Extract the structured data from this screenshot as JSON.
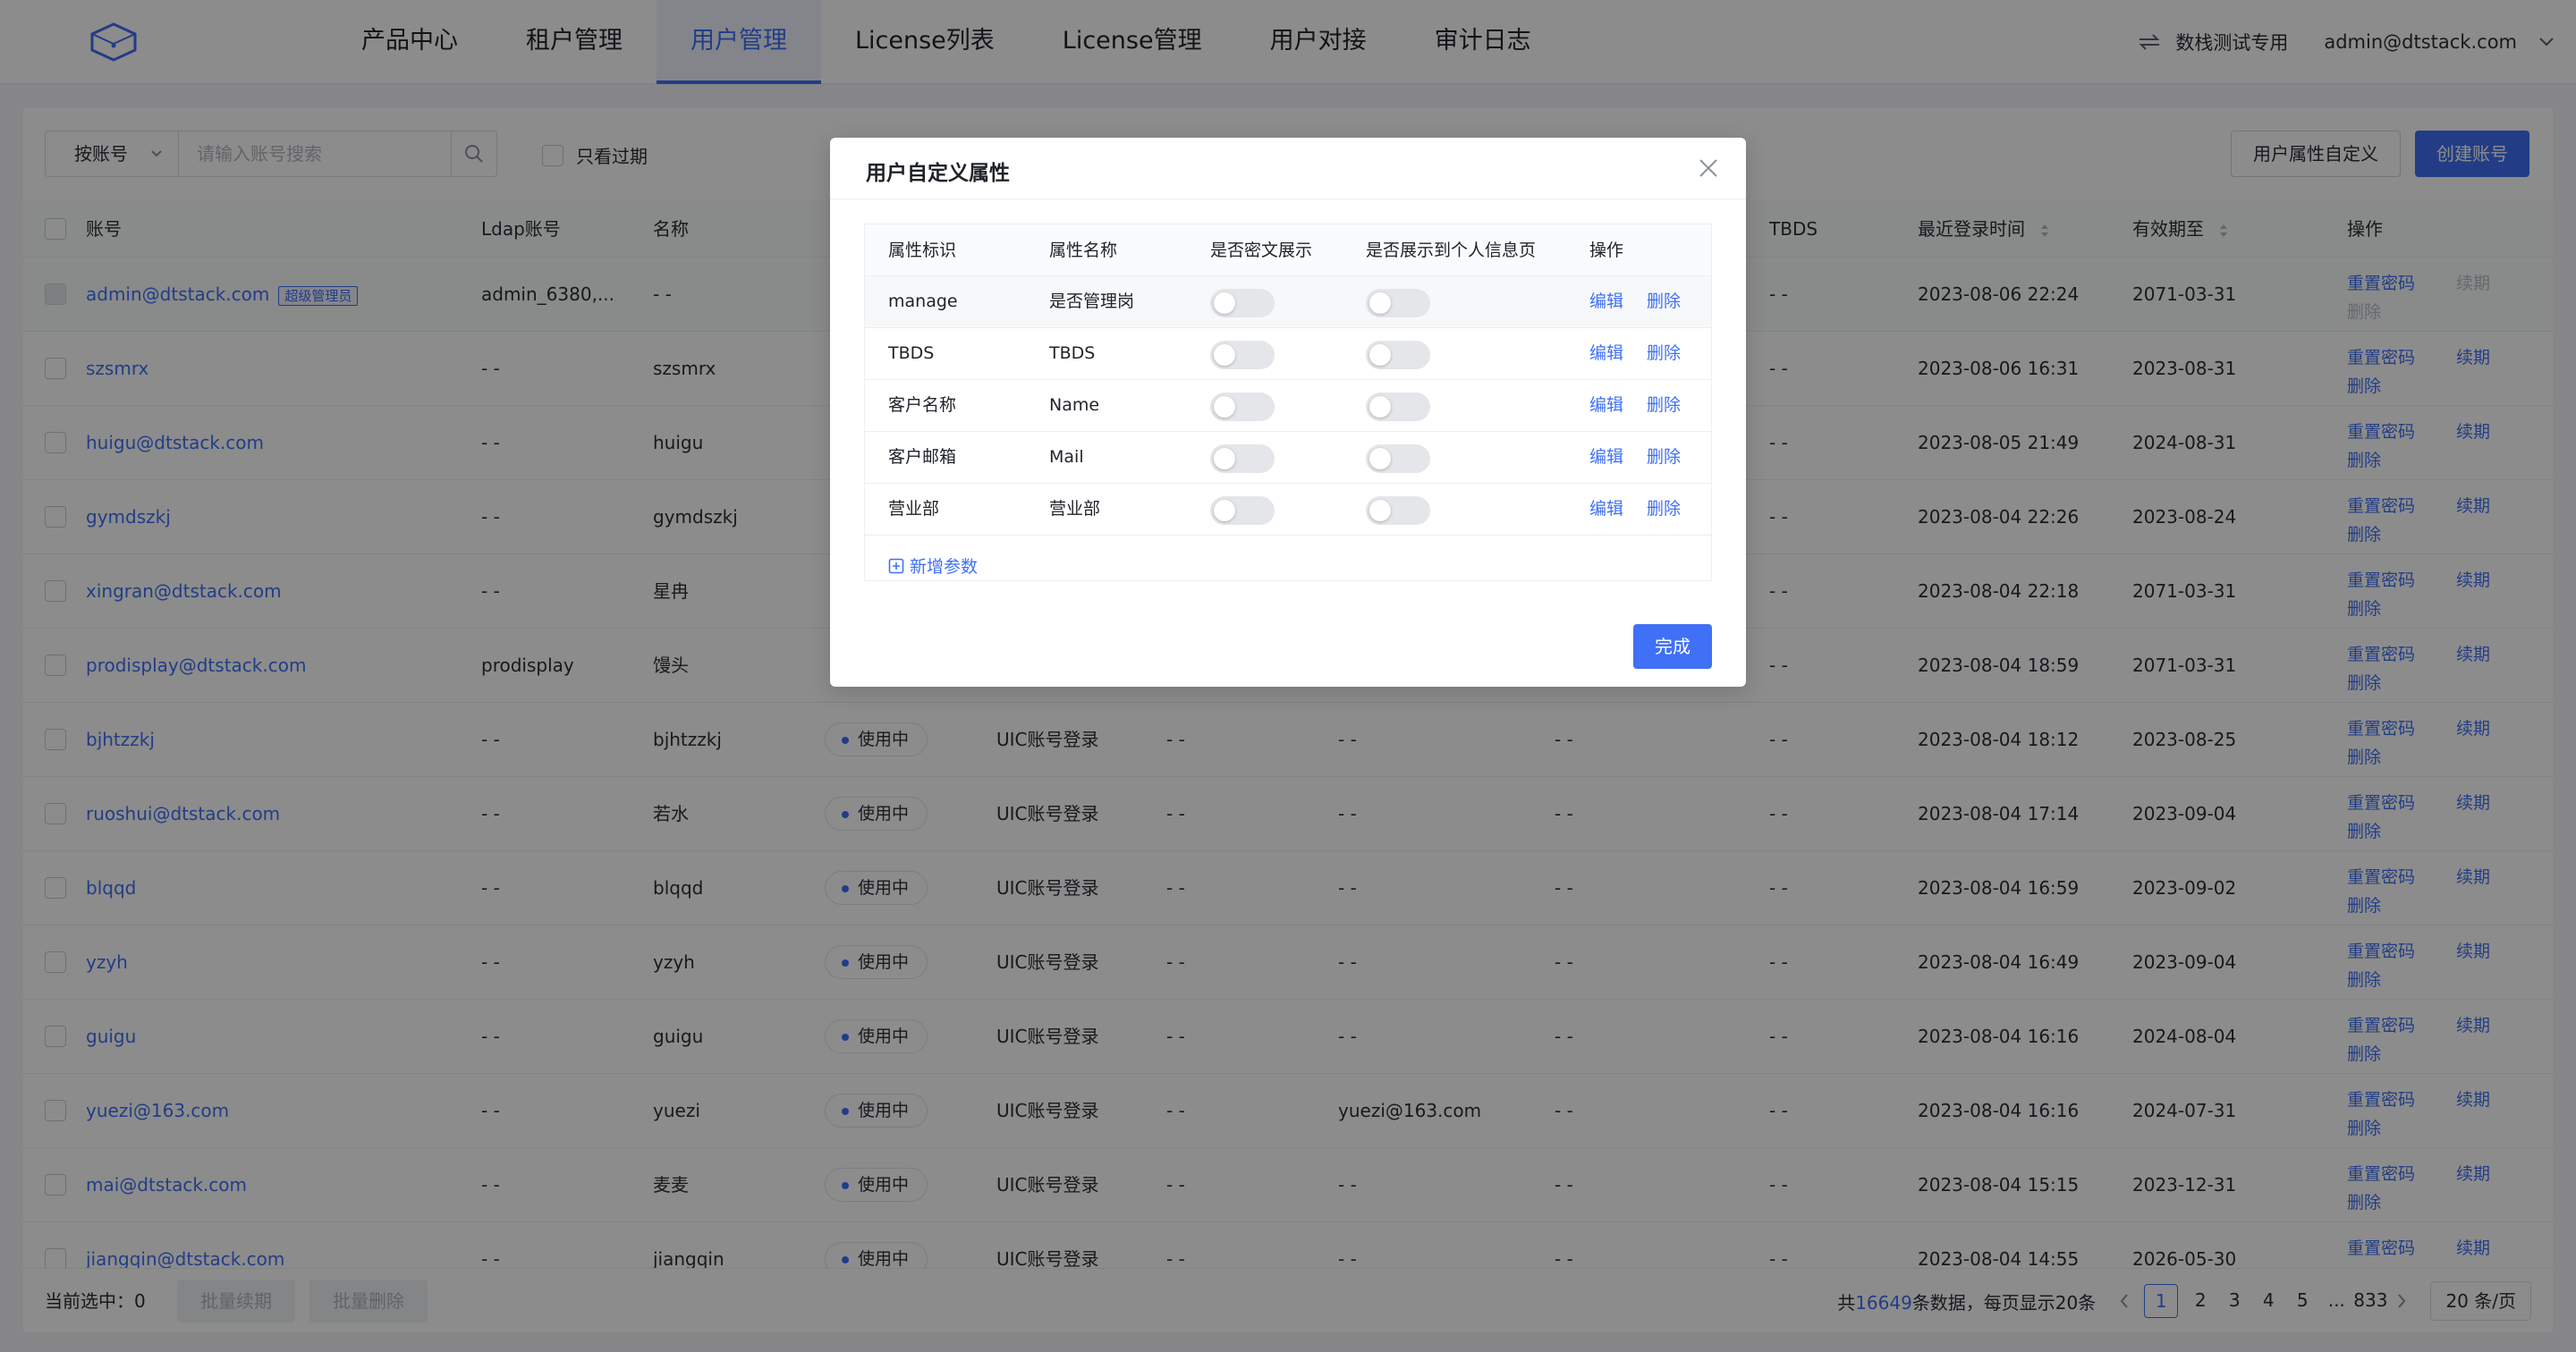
{
  "header": {
    "nav": [
      "产品中心",
      "租户管理",
      "用户管理",
      "License列表",
      "License管理",
      "用户对接",
      "审计日志"
    ],
    "active_nav": "用户管理",
    "project": "数栈测试专用",
    "user": "admin@dtstack.com",
    "accent_color": "#3f70f5"
  },
  "toolbar": {
    "search_mode": "按账号",
    "search_placeholder": "请输入账号搜索",
    "only_expired": "只看过期",
    "attr_button": "用户属性自定义",
    "create_button": "创建账号"
  },
  "table": {
    "columns": [
      "账号",
      "Ldap账号",
      "名称",
      "TBDS",
      "最近登录时间",
      "有效期至",
      "操作"
    ],
    "admin_tag": "超级管理员",
    "ops": {
      "reset": "重置密码",
      "renew": "续期",
      "delete": "删除"
    },
    "rows": [
      {
        "account": "admin@dtstack.com",
        "ldap": "admin_6380,...",
        "name": "- -",
        "status": "",
        "login_type": "",
        "c1": "",
        "c2": "",
        "c3": "",
        "tbds": "- -",
        "last_login": "2023-08-06 22:24",
        "expire": "2071-03-31",
        "admin": true
      },
      {
        "account": "szsmrx",
        "ldap": "- -",
        "name": "szsmrx",
        "status": "",
        "login_type": "",
        "c1": "",
        "c2": "",
        "c3": "",
        "tbds": "- -",
        "last_login": "2023-08-06 16:31",
        "expire": "2023-08-31"
      },
      {
        "account": "huigu@dtstack.com",
        "ldap": "- -",
        "name": "huigu",
        "status": "",
        "login_type": "",
        "c1": "",
        "c2": "",
        "c3": "",
        "tbds": "- -",
        "last_login": "2023-08-05 21:49",
        "expire": "2024-08-31"
      },
      {
        "account": "gymdszkj",
        "ldap": "- -",
        "name": "gymdszkj",
        "status": "",
        "login_type": "",
        "c1": "",
        "c2": "",
        "c3": "",
        "tbds": "- -",
        "last_login": "2023-08-04 22:26",
        "expire": "2023-08-24"
      },
      {
        "account": "xingran@dtstack.com",
        "ldap": "- -",
        "name": "星冉",
        "status": "",
        "login_type": "",
        "c1": "",
        "c2": "",
        "c3": "",
        "tbds": "- -",
        "last_login": "2023-08-04 22:18",
        "expire": "2071-03-31"
      },
      {
        "account": "prodisplay@dtstack.com",
        "ldap": "prodisplay",
        "name": "馒头",
        "status": "",
        "login_type": "",
        "c1": "",
        "c2": "",
        "c3": "",
        "tbds": "- -",
        "last_login": "2023-08-04 18:59",
        "expire": "2071-03-31"
      },
      {
        "account": "bjhtzzkj",
        "ldap": "- -",
        "name": "bjhtzzkj",
        "status": "使用中",
        "login_type": "UIC账号登录",
        "c1": "- -",
        "c2": "- -",
        "c3": "- -",
        "tbds": "- -",
        "last_login": "2023-08-04 18:12",
        "expire": "2023-08-25"
      },
      {
        "account": "ruoshui@dtstack.com",
        "ldap": "- -",
        "name": "若水",
        "status": "使用中",
        "login_type": "UIC账号登录",
        "c1": "- -",
        "c2": "- -",
        "c3": "- -",
        "tbds": "- -",
        "last_login": "2023-08-04 17:14",
        "expire": "2023-09-04"
      },
      {
        "account": "blqqd",
        "ldap": "- -",
        "name": "blqqd",
        "status": "使用中",
        "login_type": "UIC账号登录",
        "c1": "- -",
        "c2": "- -",
        "c3": "- -",
        "tbds": "- -",
        "last_login": "2023-08-04 16:59",
        "expire": "2023-09-02"
      },
      {
        "account": "yzyh",
        "ldap": "- -",
        "name": "yzyh",
        "status": "使用中",
        "login_type": "UIC账号登录",
        "c1": "- -",
        "c2": "- -",
        "c3": "- -",
        "tbds": "- -",
        "last_login": "2023-08-04 16:49",
        "expire": "2023-09-04"
      },
      {
        "account": "guigu",
        "ldap": "- -",
        "name": "guigu",
        "status": "使用中",
        "login_type": "UIC账号登录",
        "c1": "- -",
        "c2": "- -",
        "c3": "- -",
        "tbds": "- -",
        "last_login": "2023-08-04 16:16",
        "expire": "2024-08-04"
      },
      {
        "account": "yuezi@163.com",
        "ldap": "- -",
        "name": "yuezi",
        "status": "使用中",
        "login_type": "UIC账号登录",
        "c1": "- -",
        "c2": "yuezi@163.com",
        "c3": "- -",
        "tbds": "- -",
        "last_login": "2023-08-04 16:16",
        "expire": "2024-07-31"
      },
      {
        "account": "mai@dtstack.com",
        "ldap": "- -",
        "name": "麦麦",
        "status": "使用中",
        "login_type": "UIC账号登录",
        "c1": "- -",
        "c2": "- -",
        "c3": "- -",
        "tbds": "- -",
        "last_login": "2023-08-04 15:15",
        "expire": "2023-12-31"
      },
      {
        "account": "jiangqin@dtstack.com",
        "ldap": "- -",
        "name": "jiangqin",
        "status": "使用中",
        "login_type": "UIC账号登录",
        "c1": "- -",
        "c2": "- -",
        "c3": "- -",
        "tbds": "- -",
        "last_login": "2023-08-04 14:55",
        "expire": "2026-05-30"
      }
    ]
  },
  "footer": {
    "selected": "当前选中：0",
    "batch_renew": "批量续期",
    "batch_delete": "批量删除",
    "total_prefix": "共",
    "total": "16649",
    "total_suffix": "条数据，每页显示20条",
    "pages": [
      "1",
      "2",
      "3",
      "4",
      "5",
      "...",
      "833"
    ],
    "current_page": "1",
    "page_size": "20 条/页"
  },
  "modal": {
    "title": "用户自定义属性",
    "columns": [
      "属性标识",
      "属性名称",
      "是否密文展示",
      "是否展示到个人信息页",
      "操作"
    ],
    "rows": [
      {
        "key": "manage",
        "name": "是否管理岗",
        "cipher": false,
        "show": false
      },
      {
        "key": "TBDS",
        "name": "TBDS",
        "cipher": false,
        "show": false
      },
      {
        "key": "客户名称",
        "name": "Name",
        "cipher": false,
        "show": false
      },
      {
        "key": "客户邮箱",
        "name": "Mail",
        "cipher": false,
        "show": false
      },
      {
        "key": "营业部",
        "name": "营业部",
        "cipher": false,
        "show": false
      }
    ],
    "edit": "编辑",
    "delete": "删除",
    "add_param": "新增参数",
    "done": "完成"
  }
}
